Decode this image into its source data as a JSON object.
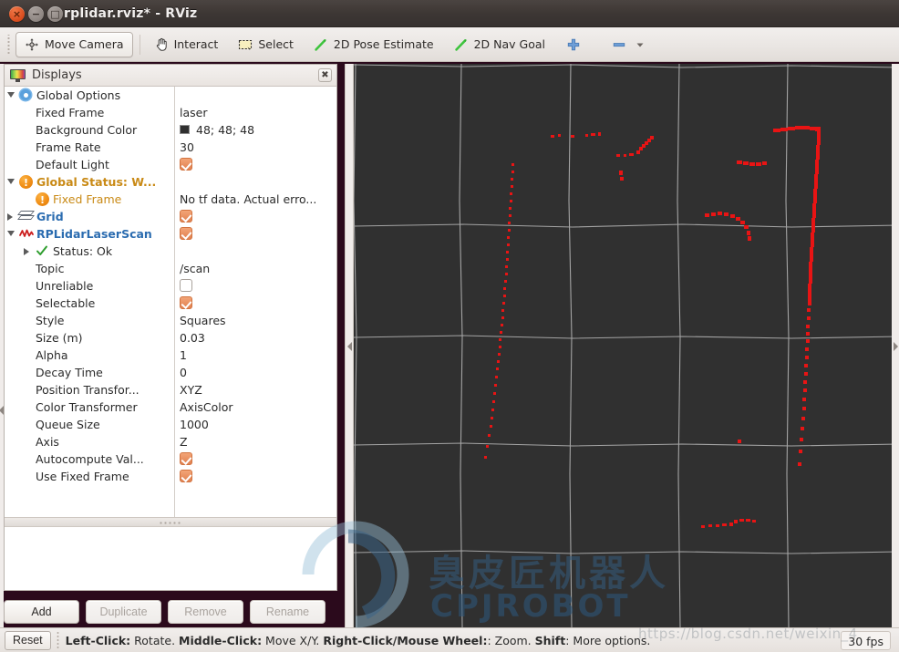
{
  "window": {
    "title": "rplidar.rviz* - RViz",
    "close_label": "×",
    "minimize_label": "−",
    "maximize_label": "□"
  },
  "toolbar": {
    "items": [
      {
        "label": "Move Camera",
        "icon": "move-camera-icon",
        "active": true
      },
      {
        "label": "Interact",
        "icon": "hand-pointer-icon",
        "active": false
      },
      {
        "label": "Select",
        "icon": "select-rect-icon",
        "active": false
      },
      {
        "label": "2D Pose Estimate",
        "icon": "pose-arrow-icon",
        "active": false
      },
      {
        "label": "2D Nav Goal",
        "icon": "nav-goal-arrow-icon",
        "active": false
      },
      {
        "label": "",
        "icon": "plus-icon",
        "active": false
      },
      {
        "label": "",
        "icon": "minus-icon",
        "active": false
      }
    ]
  },
  "displays_panel": {
    "title": "Displays",
    "close_label": "✖",
    "rows": [
      {
        "indent": 1,
        "arrow": "open",
        "icon": "gear-icon",
        "name": "Global Options",
        "style": "plain",
        "value_type": "none"
      },
      {
        "indent": 2,
        "arrow": "none",
        "icon": "none",
        "name": "Fixed Frame",
        "style": "plain",
        "value_type": "text",
        "value": "laser"
      },
      {
        "indent": 2,
        "arrow": "none",
        "icon": "none",
        "name": "Background Color",
        "style": "plain",
        "value_type": "color",
        "value": "48; 48; 48",
        "swatch": "#303030"
      },
      {
        "indent": 2,
        "arrow": "none",
        "icon": "none",
        "name": "Frame Rate",
        "style": "plain",
        "value_type": "text",
        "value": "30"
      },
      {
        "indent": 2,
        "arrow": "none",
        "icon": "none",
        "name": "Default Light",
        "style": "plain",
        "value_type": "checked"
      },
      {
        "indent": 1,
        "arrow": "open",
        "icon": "warning-icon",
        "name": "Global Status: W...",
        "style": "warn",
        "value_type": "none"
      },
      {
        "indent": 2,
        "arrow": "none",
        "icon": "warning-icon",
        "name": "Fixed Frame",
        "style": "warnsub",
        "value_type": "text",
        "value": "No tf data.  Actual erro..."
      },
      {
        "indent": 1,
        "arrow": "closed",
        "icon": "grid-icon",
        "name": "Grid",
        "style": "link",
        "value_type": "checked"
      },
      {
        "indent": 1,
        "arrow": "open",
        "icon": "scan-icon",
        "name": "RPLidarLaserScan",
        "style": "link",
        "value_type": "checked"
      },
      {
        "indent": 2,
        "arrow": "closed",
        "icon": "checkmark-icon",
        "name": "Status: Ok",
        "style": "plain",
        "value_type": "none"
      },
      {
        "indent": 2,
        "arrow": "none",
        "icon": "none",
        "name": "Topic",
        "style": "plain",
        "value_type": "text",
        "value": "/scan"
      },
      {
        "indent": 2,
        "arrow": "none",
        "icon": "none",
        "name": "Unreliable",
        "style": "plain",
        "value_type": "unchecked"
      },
      {
        "indent": 2,
        "arrow": "none",
        "icon": "none",
        "name": "Selectable",
        "style": "plain",
        "value_type": "checked"
      },
      {
        "indent": 2,
        "arrow": "none",
        "icon": "none",
        "name": "Style",
        "style": "plain",
        "value_type": "text",
        "value": "Squares"
      },
      {
        "indent": 2,
        "arrow": "none",
        "icon": "none",
        "name": "Size (m)",
        "style": "plain",
        "value_type": "text",
        "value": "0.03"
      },
      {
        "indent": 2,
        "arrow": "none",
        "icon": "none",
        "name": "Alpha",
        "style": "plain",
        "value_type": "text",
        "value": "1"
      },
      {
        "indent": 2,
        "arrow": "none",
        "icon": "none",
        "name": "Decay Time",
        "style": "plain",
        "value_type": "text",
        "value": "0"
      },
      {
        "indent": 2,
        "arrow": "none",
        "icon": "none",
        "name": "Position Transfor...",
        "style": "plain",
        "value_type": "text",
        "value": "XYZ"
      },
      {
        "indent": 2,
        "arrow": "none",
        "icon": "none",
        "name": "Color Transformer",
        "style": "plain",
        "value_type": "text",
        "value": "AxisColor"
      },
      {
        "indent": 2,
        "arrow": "none",
        "icon": "none",
        "name": "Queue Size",
        "style": "plain",
        "value_type": "text",
        "value": "1000"
      },
      {
        "indent": 2,
        "arrow": "none",
        "icon": "none",
        "name": "Axis",
        "style": "plain",
        "value_type": "text",
        "value": "Z"
      },
      {
        "indent": 2,
        "arrow": "none",
        "icon": "none",
        "name": "Autocompute Val...",
        "style": "plain",
        "value_type": "checked"
      },
      {
        "indent": 2,
        "arrow": "none",
        "icon": "none",
        "name": "Use Fixed Frame",
        "style": "plain",
        "value_type": "checked"
      }
    ],
    "buttons": [
      {
        "label": "Add",
        "enabled": true
      },
      {
        "label": "Duplicate",
        "enabled": false
      },
      {
        "label": "Remove",
        "enabled": false
      },
      {
        "label": "Rename",
        "enabled": false
      }
    ]
  },
  "statusbar": {
    "reset_label": "Reset",
    "hint_segments": [
      {
        "text": "Left-Click:",
        "bold": true
      },
      {
        "text": " Rotate. ",
        "bold": false
      },
      {
        "text": "Middle-Click:",
        "bold": true
      },
      {
        "text": " Move X/Y. ",
        "bold": false
      },
      {
        "text": "Right-Click/Mouse Wheel:",
        "bold": true
      },
      {
        "text": ": Zoom. ",
        "bold": false
      },
      {
        "text": "Shift",
        "bold": true
      },
      {
        "text": ": More options.",
        "bold": false
      }
    ],
    "fps": "30 fps"
  },
  "view3d": {
    "background_color": "#303030",
    "grid_color": "#b9b9b9",
    "point_color": "#e81414",
    "grid_cols": 6,
    "grid_rows": 6
  },
  "watermark": {
    "cn": "臭皮匠机器人",
    "en": "CPJROBOT",
    "url": "https://blog.csdn.net/weixin_4"
  }
}
